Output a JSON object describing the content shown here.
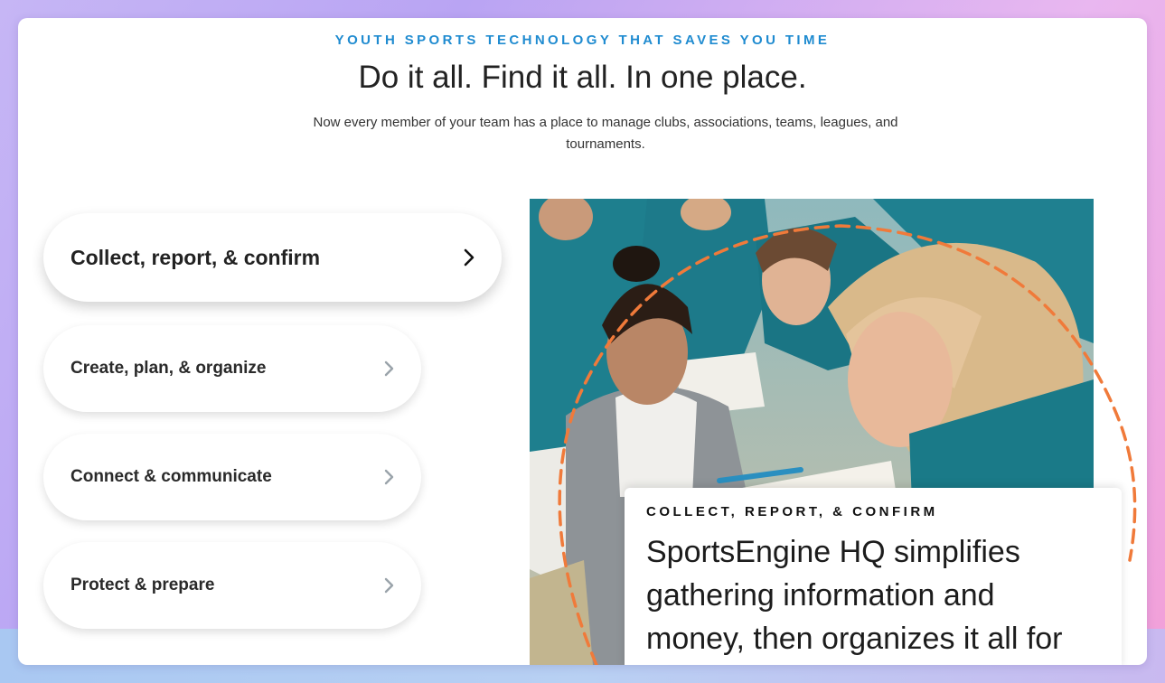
{
  "header": {
    "eyebrow": "YOUTH SPORTS TECHNOLOGY THAT SAVES YOU TIME",
    "title": "Do it all. Find it all. In one place.",
    "subtitle": "Now every member of your team has a place to manage clubs, associations, teams, leagues, and tournaments."
  },
  "accordion": {
    "items": [
      {
        "label": "Collect, report, & confirm",
        "active": true,
        "icon": "chevron-right-icon"
      },
      {
        "label": "Create, plan, & organize",
        "active": false,
        "icon": "chevron-right-icon"
      },
      {
        "label": "Connect & communicate",
        "active": false,
        "icon": "chevron-right-icon"
      },
      {
        "label": "Protect & prepare",
        "active": false,
        "icon": "chevron-right-icon"
      }
    ]
  },
  "feature": {
    "eyebrow": "COLLECT, REPORT, & CONFIRM",
    "text": "SportsEngine HQ simplifies gathering information and money, then organizes it all for"
  },
  "colors": {
    "accent": "#1f8bd0",
    "dashed_ring": "#f07a3a",
    "jersey_teal": "#1e7f8e",
    "chevron_inactive": "#9aa3aa",
    "chevron_active": "#111111"
  }
}
